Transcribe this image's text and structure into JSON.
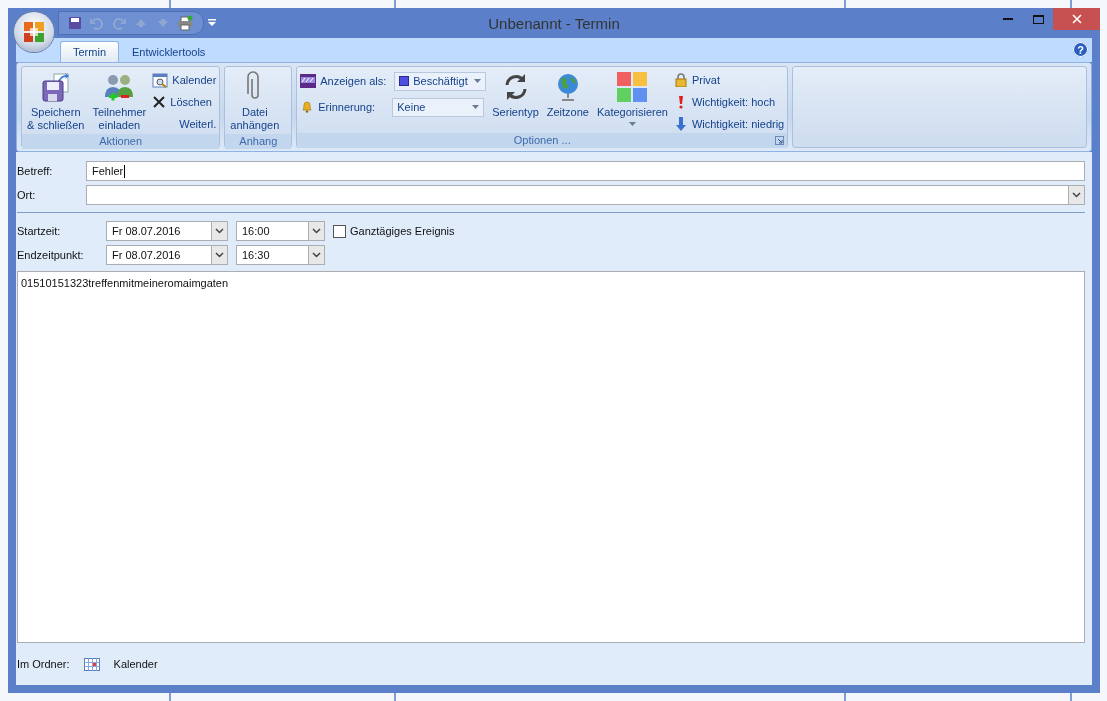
{
  "window": {
    "title": "Unbenannt - Termin"
  },
  "tabs": [
    {
      "label": "Termin",
      "selected": true
    },
    {
      "label": "Entwicklertools",
      "selected": false
    }
  ],
  "help_button": {
    "label": "?"
  },
  "ribbon": {
    "groups": [
      {
        "title": "Aktionen",
        "launcher": false,
        "items": [
          {
            "kind": "large",
            "label": "Speichern\n& schließen",
            "has_menu": false
          },
          {
            "kind": "large",
            "label": "Teilnehmer\neinladen",
            "has_menu": false
          },
          {
            "kind": "small",
            "label": "Kalender"
          },
          {
            "kind": "small",
            "label": "Löschen"
          },
          {
            "kind": "text",
            "label": "Weiterl."
          }
        ]
      },
      {
        "title": "Anhang",
        "launcher": false,
        "items": [
          {
            "kind": "large",
            "label": "Datei\nanhängen",
            "has_menu": false
          }
        ]
      },
      {
        "title": "Optionen ...",
        "launcher": true,
        "items": [
          {
            "kind": "field",
            "label": "Anzeigen als:",
            "value": "Beschäftigt",
            "swatch": true
          },
          {
            "kind": "field",
            "label": "Erinnerung:",
            "value": "Keine",
            "swatch": false
          },
          {
            "kind": "large",
            "label": "Serientyp",
            "has_menu": false
          },
          {
            "kind": "large",
            "label": "Zeitzone",
            "has_menu": false
          },
          {
            "kind": "large",
            "label": "Kategorisieren",
            "has_menu": true
          },
          {
            "kind": "small",
            "label": "Privat"
          },
          {
            "kind": "small",
            "label": "Wichtigkeit: hoch"
          },
          {
            "kind": "small",
            "label": "Wichtigkeit: niedrig"
          }
        ]
      }
    ]
  },
  "form": {
    "subject": {
      "label": "Betreff:",
      "value": "Fehler"
    },
    "location": {
      "label": "Ort:"
    },
    "start": {
      "label": "Startzeit:",
      "date": "Fr 08.07.2016",
      "time": "16:00"
    },
    "end": {
      "label": "Endzeitpunkt:",
      "date": "Fr 08.07.2016",
      "time": "16:30"
    },
    "all_day": {
      "label": "Ganztägiges Ereignis",
      "checked": false
    },
    "body": "01510151323treffenmitmeineromaimgaten",
    "folder": {
      "label": "Im Ordner:",
      "value": "Kalender"
    }
  }
}
